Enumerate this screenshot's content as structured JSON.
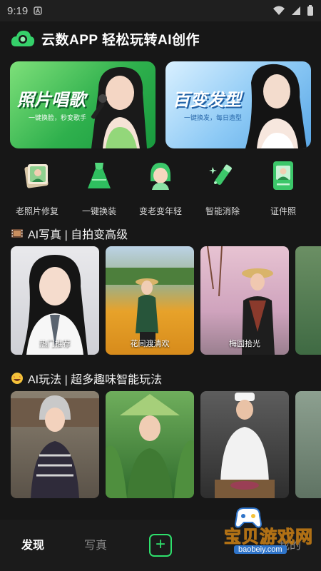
{
  "status_bar": {
    "time": "9:19"
  },
  "header": {
    "title": "云数APP 轻松玩转AI创作"
  },
  "banners": [
    {
      "title": "照片唱歌",
      "subtitle": "一键换脸，秒变歌手"
    },
    {
      "title": "百变发型",
      "subtitle": "一键换发，每日造型"
    }
  ],
  "tools": [
    {
      "label": "老照片修复",
      "icon": "old-photo-icon"
    },
    {
      "label": "一键换装",
      "icon": "dress-icon"
    },
    {
      "label": "变老变年轻",
      "icon": "face-age-icon"
    },
    {
      "label": "智能消除",
      "icon": "magic-eraser-icon"
    },
    {
      "label": "证件照",
      "icon": "id-photo-icon"
    }
  ],
  "section_portrait": {
    "title": "AI写真 | 自拍变高级",
    "cards": [
      "热门推荐",
      "花间渡清欢",
      "梅园拾光",
      ""
    ]
  },
  "section_play": {
    "title": "AI玩法 | 超多趣味智能玩法"
  },
  "bottom_nav": {
    "discover": "发现",
    "portrait": "写真",
    "add": "+",
    "mine": "我的"
  },
  "watermark": {
    "text": "宝贝游戏网",
    "url": "baobeiy.com"
  },
  "colors": {
    "accent": "#2ee06c",
    "background": "#171717"
  }
}
